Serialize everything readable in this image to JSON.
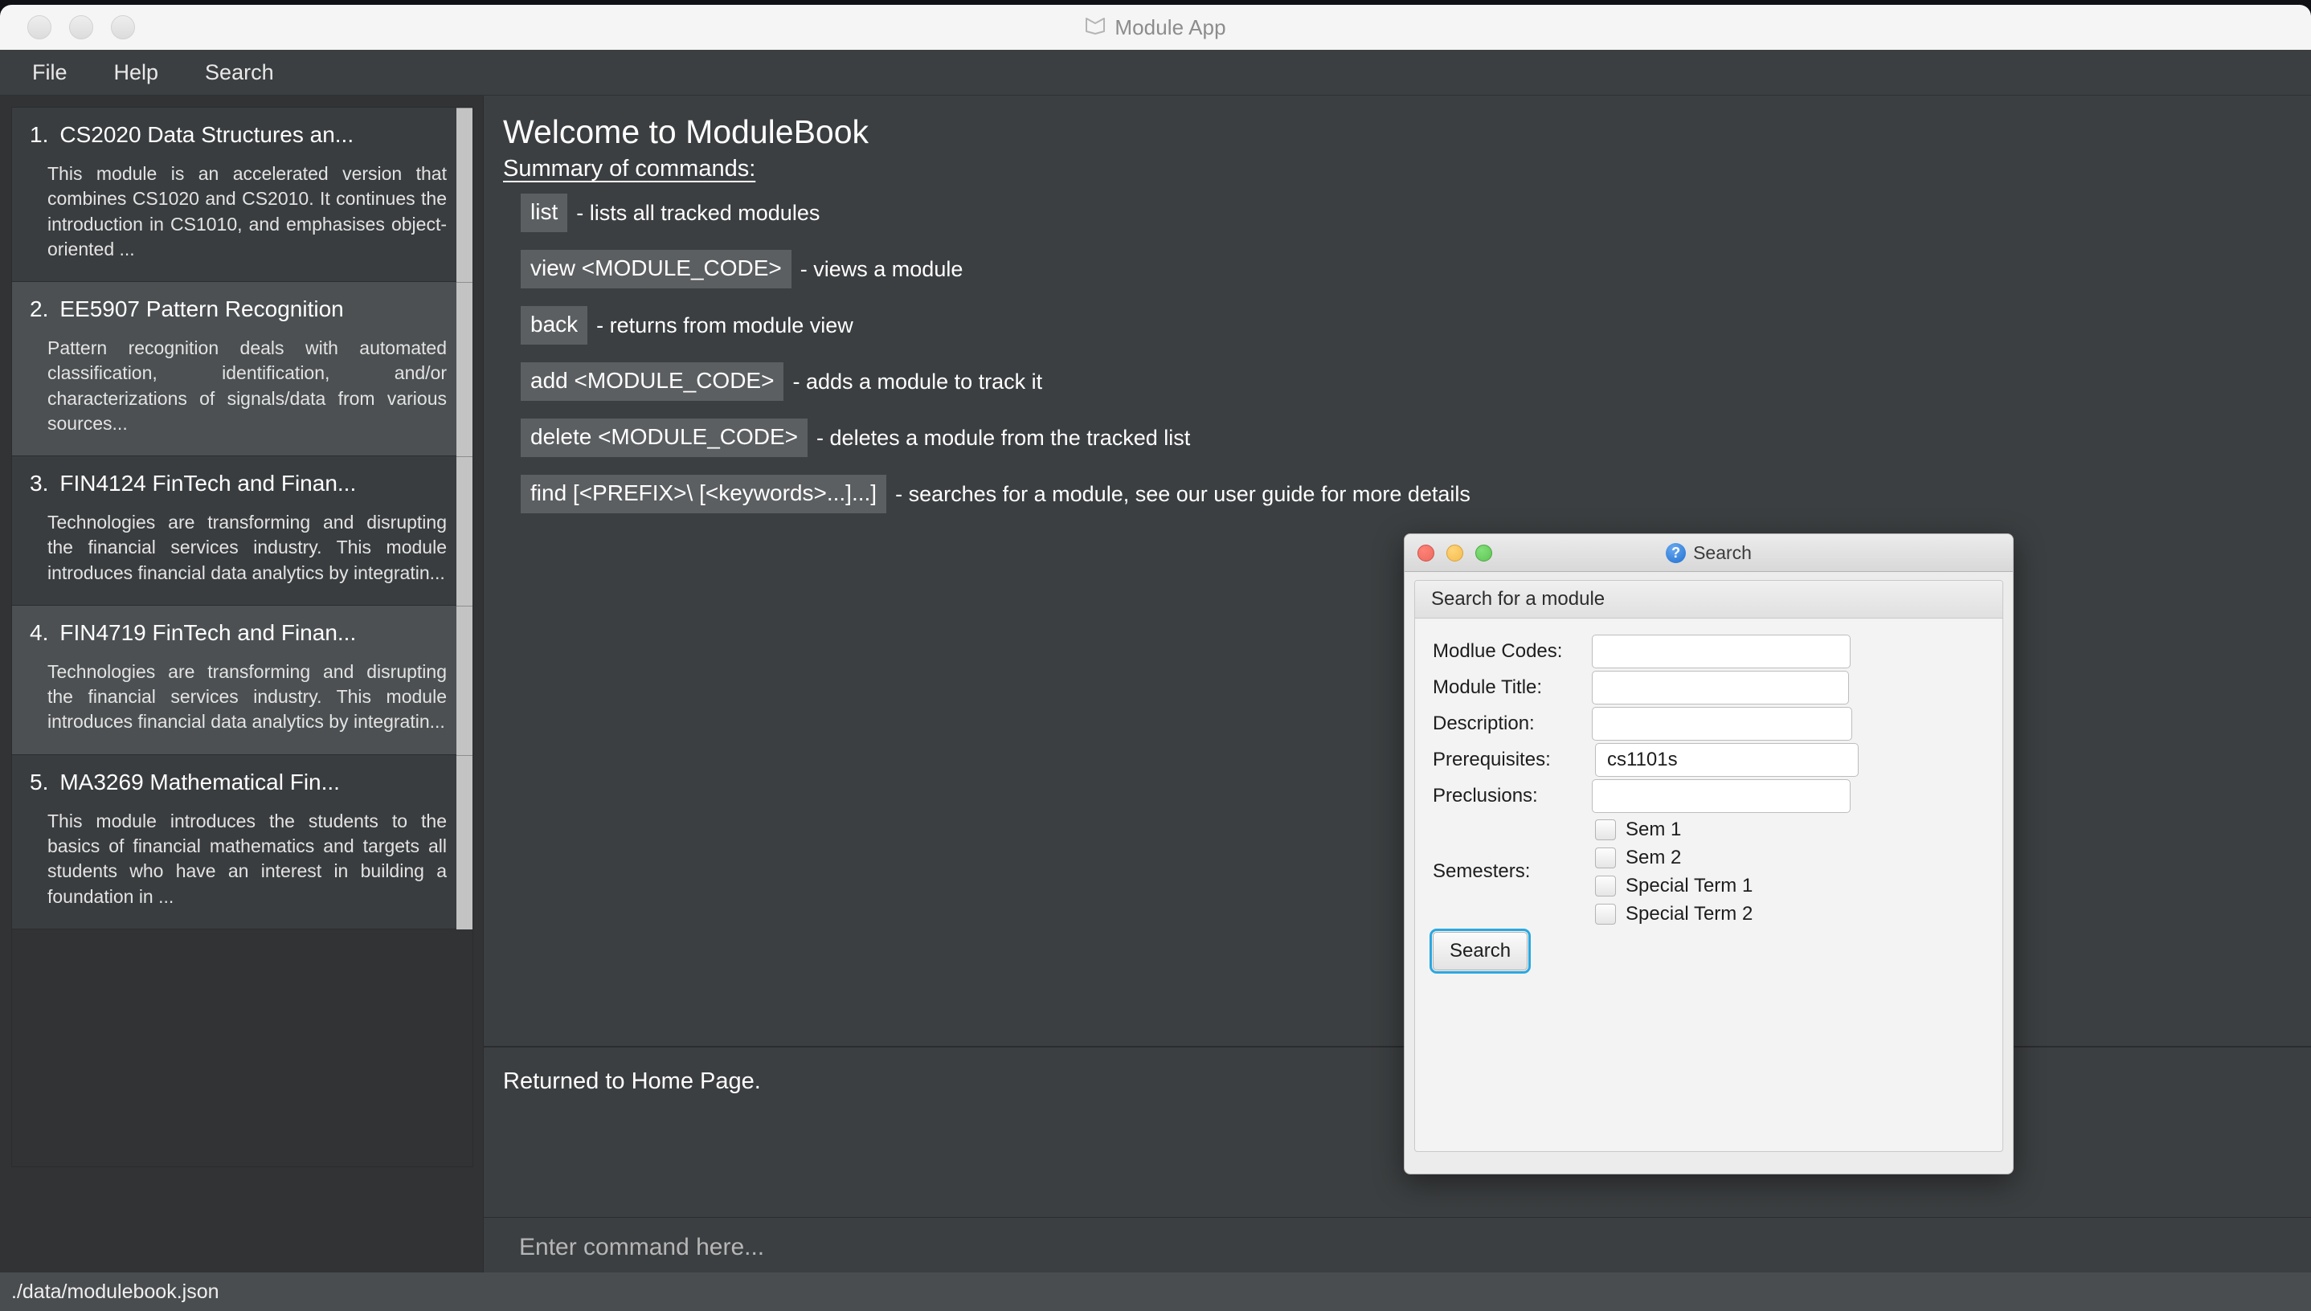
{
  "window": {
    "title": "Module App",
    "icon": "book-icon",
    "traffic_lights": [
      "close",
      "minimize",
      "zoom"
    ]
  },
  "menubar": {
    "items": [
      {
        "label": "File",
        "name": "menu-item-file"
      },
      {
        "label": "Help",
        "name": "menu-item-help"
      },
      {
        "label": "Search",
        "name": "menu-item-search"
      }
    ]
  },
  "sidebar": {
    "modules": [
      {
        "index": "1.",
        "title": "CS2020 Data Structures an...",
        "description": "This module is an accelerated version that combines CS1020 and CS2010. It continues the introduction in CS1010, and emphasises object-oriented ...",
        "highlighted": false
      },
      {
        "index": "2.",
        "title": "EE5907 Pattern Recognition",
        "description": "Pattern recognition deals with automated classification, identification, and/or characterizations of signals/data from various sources...",
        "highlighted": true
      },
      {
        "index": "3.",
        "title": "FIN4124 FinTech and Finan...",
        "description": "Technologies are transforming and disrupting the financial services industry. This module introduces financial data analytics by integratin...",
        "highlighted": false
      },
      {
        "index": "4.",
        "title": "FIN4719 FinTech and Finan...",
        "description": "Technologies are transforming and disrupting the financial services industry. This module introduces financial data analytics by integratin...",
        "highlighted": true
      },
      {
        "index": "5.",
        "title": "MA3269 Mathematical Fin...",
        "description": "This module introduces the students to the basics of financial mathematics and targets all students who have an interest in building a foundation in ...",
        "highlighted": false
      }
    ]
  },
  "main": {
    "welcome_title": "Welcome to ModuleBook",
    "summary_label": "Summary of commands:",
    "commands": [
      {
        "chip": "list",
        "desc": "- lists all tracked modules"
      },
      {
        "chip": "view <MODULE_CODE>",
        "desc": "- views a module"
      },
      {
        "chip": "back",
        "desc": "- returns from module view"
      },
      {
        "chip": "add <MODULE_CODE>",
        "desc": "- adds a module to track it"
      },
      {
        "chip": "delete <MODULE_CODE>",
        "desc": "- deletes a module from the tracked list"
      },
      {
        "chip": "find [<PREFIX>\\ [<keywords>...]...]",
        "desc": "- searches for a module, see our user guide for more details"
      }
    ],
    "result_text": "Returned to Home Page.",
    "command_placeholder": "Enter command here..."
  },
  "statusbar": {
    "path": "./data/modulebook.json"
  },
  "search_dialog": {
    "title": "Search",
    "icon": "question-mark-icon",
    "panel_header": "Search for a module",
    "fields": [
      {
        "label": "Modlue Codes:",
        "value": "",
        "name": "module-codes"
      },
      {
        "label": "Module Title:",
        "value": "",
        "name": "module-title"
      },
      {
        "label": "Description:",
        "value": "",
        "name": "description"
      },
      {
        "label": "Prerequisites:",
        "value": "cs1101s",
        "name": "prerequisites"
      },
      {
        "label": "Preclusions:",
        "value": "",
        "name": "preclusions"
      }
    ],
    "semesters_label": "Semesters:",
    "semesters": [
      {
        "label": "Sem 1",
        "checked": false
      },
      {
        "label": "Sem 2",
        "checked": false
      },
      {
        "label": "Special Term 1",
        "checked": false
      },
      {
        "label": "Special Term 2",
        "checked": false
      }
    ],
    "search_button": "Search",
    "accent_focus_color": "#29a8e0"
  }
}
